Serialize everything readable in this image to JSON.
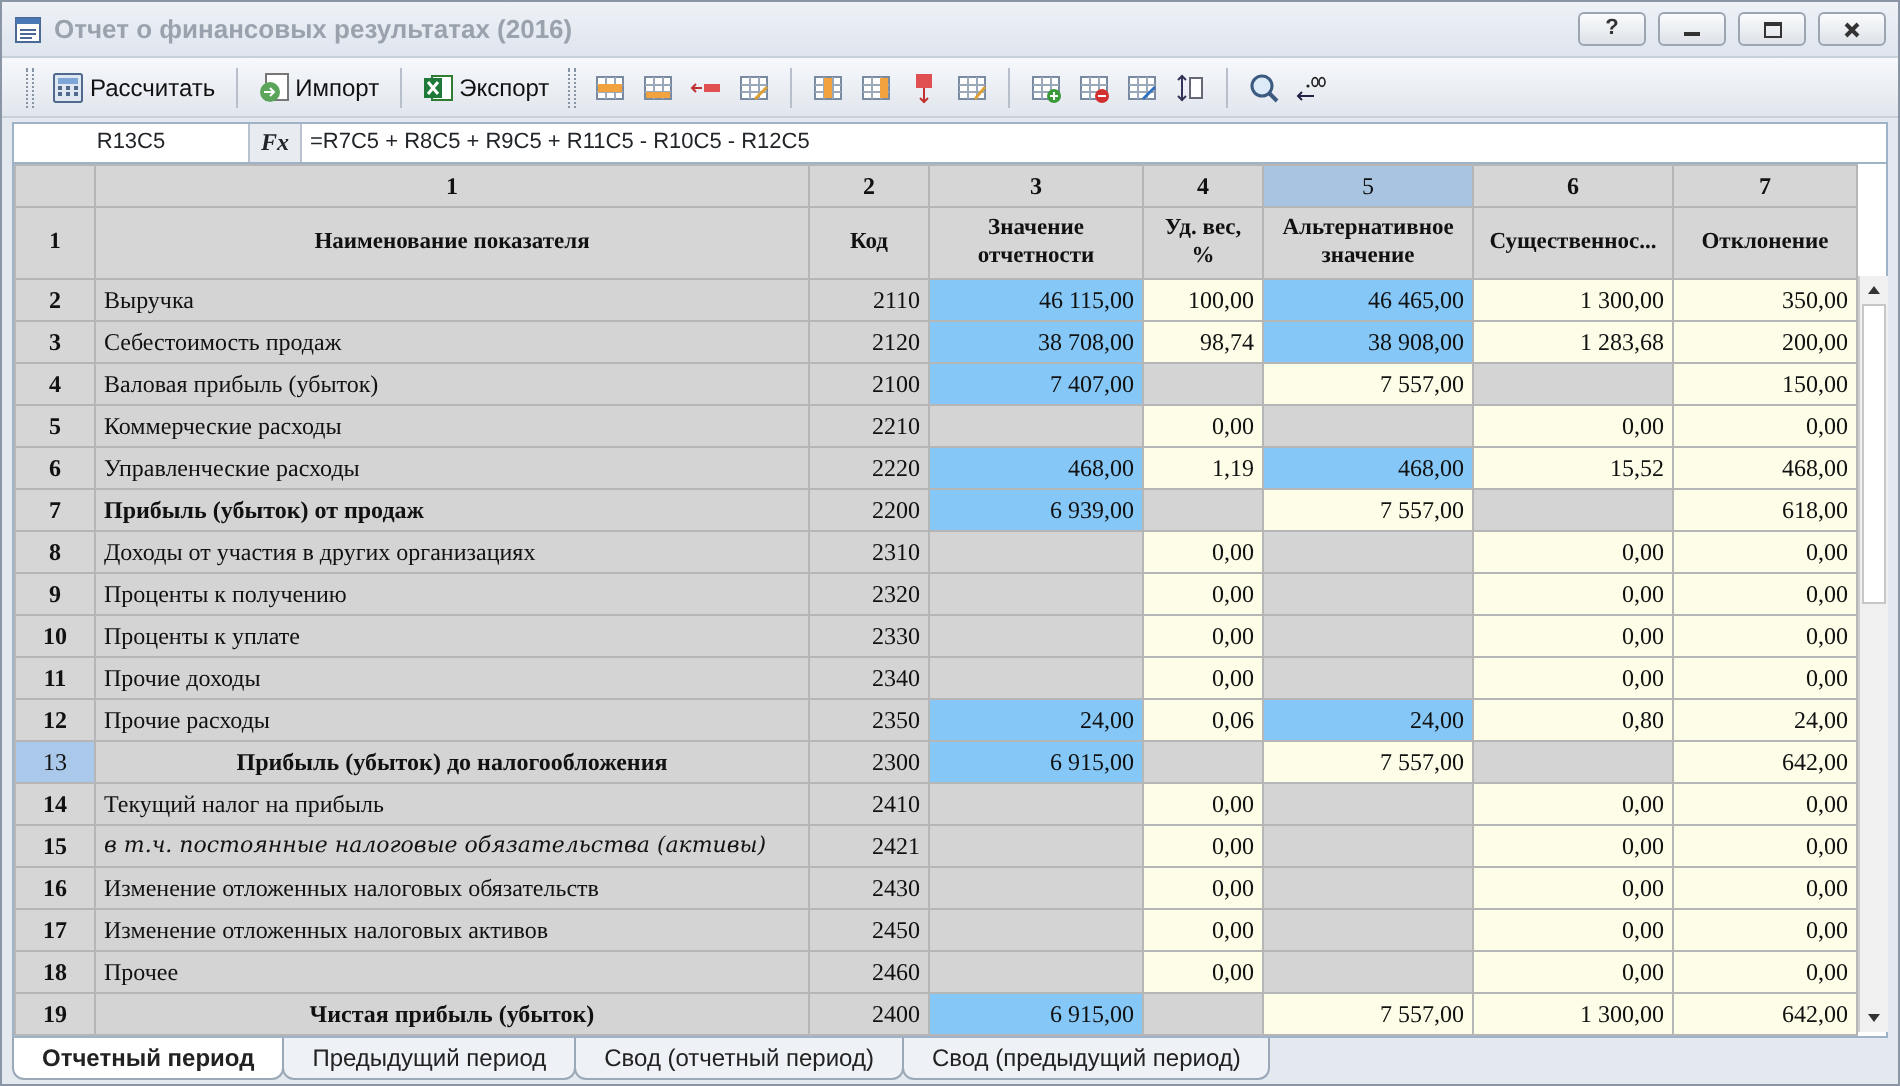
{
  "window": {
    "title": "Отчет о финансовых результатах (2016)",
    "help_button": "?"
  },
  "toolbar": {
    "buttons": [
      {
        "label": "Рассчитать",
        "kind": "calculator"
      },
      {
        "label": "Импорт",
        "kind": "import"
      },
      {
        "label": "Экспорт",
        "kind": "excel"
      }
    ]
  },
  "formula_bar": {
    "cell": "R13C5",
    "fx_label": "Fx",
    "formula": "=R7C5 + R8C5 + R9C5 + R11C5 - R10C5 - R12C5"
  },
  "table": {
    "column_numbers": [
      {
        "label": "1",
        "selected": false
      },
      {
        "label": "2",
        "selected": false
      },
      {
        "label": "3",
        "selected": false
      },
      {
        "label": "4",
        "selected": false
      },
      {
        "label": "5",
        "selected": true
      },
      {
        "label": "6",
        "selected": false
      },
      {
        "label": "7",
        "selected": false
      }
    ],
    "columns": [
      "1",
      "Наименование показателя",
      "Код",
      "Значение отчетности",
      "Уд. вес, %",
      "Альтернативное значение",
      "Существеннос...",
      "Отклонение"
    ],
    "rows": [
      {
        "selected": false,
        "kind": "plain",
        "cells": [
          {
            "value": "2",
            "kind": "number"
          },
          {
            "value": "Выручка",
            "kind": "name"
          },
          {
            "value": "2110",
            "kind": "code"
          },
          {
            "value": "46 115,00",
            "kind": "input"
          },
          {
            "value": "100,00",
            "kind": "calc"
          },
          {
            "value": "46 465,00",
            "kind": "input"
          },
          {
            "value": "1 300,00",
            "kind": "calc"
          },
          {
            "value": "350,00",
            "kind": "calc"
          }
        ]
      },
      {
        "selected": false,
        "kind": "plain",
        "cells": [
          {
            "value": "3",
            "kind": "number"
          },
          {
            "value": "Себестоимость продаж",
            "kind": "name"
          },
          {
            "value": "2120",
            "kind": "code"
          },
          {
            "value": "38 708,00",
            "kind": "input"
          },
          {
            "value": "98,74",
            "kind": "calc"
          },
          {
            "value": "38 908,00",
            "kind": "input"
          },
          {
            "value": "1 283,68",
            "kind": "calc"
          },
          {
            "value": "200,00",
            "kind": "calc"
          }
        ]
      },
      {
        "selected": false,
        "kind": "plain",
        "cells": [
          {
            "value": "4",
            "kind": "number"
          },
          {
            "value": "Валовая прибыль (убыток)",
            "kind": "name"
          },
          {
            "value": "2100",
            "kind": "code"
          },
          {
            "value": "7 407,00",
            "kind": "input"
          },
          {
            "kind": "locked"
          },
          {
            "value": "7 557,00",
            "kind": "calc"
          },
          {
            "kind": "locked"
          },
          {
            "value": "150,00",
            "kind": "calc"
          }
        ]
      },
      {
        "selected": false,
        "kind": "plain",
        "cells": [
          {
            "value": "5",
            "kind": "number"
          },
          {
            "value": "Коммерческие расходы",
            "kind": "name"
          },
          {
            "value": "2210",
            "kind": "code"
          },
          {
            "kind": "locked"
          },
          {
            "value": "0,00",
            "kind": "calc"
          },
          {
            "kind": "locked"
          },
          {
            "value": "0,00",
            "kind": "calc"
          },
          {
            "value": "0,00",
            "kind": "calc"
          }
        ]
      },
      {
        "selected": false,
        "kind": "plain",
        "cells": [
          {
            "value": "6",
            "kind": "number"
          },
          {
            "value": "Управленческие расходы",
            "kind": "name"
          },
          {
            "value": "2220",
            "kind": "code"
          },
          {
            "value": "468,00",
            "kind": "input"
          },
          {
            "value": "1,19",
            "kind": "calc"
          },
          {
            "value": "468,00",
            "kind": "input"
          },
          {
            "value": "15,52",
            "kind": "calc"
          },
          {
            "value": "468,00",
            "kind": "calc"
          }
        ]
      },
      {
        "selected": false,
        "kind": "bold",
        "cells": [
          {
            "value": "7",
            "kind": "number"
          },
          {
            "value": "Прибыль (убыток) от продаж",
            "kind": "name"
          },
          {
            "value": "2200",
            "kind": "code"
          },
          {
            "value": "6 939,00",
            "kind": "input"
          },
          {
            "kind": "locked"
          },
          {
            "value": "7 557,00",
            "kind": "calc"
          },
          {
            "kind": "locked"
          },
          {
            "value": "618,00",
            "kind": "calc"
          }
        ]
      },
      {
        "selected": false,
        "kind": "plain",
        "cells": [
          {
            "value": "8",
            "kind": "number"
          },
          {
            "value": "Доходы от участия в других организациях",
            "kind": "name"
          },
          {
            "value": "2310",
            "kind": "code"
          },
          {
            "kind": "locked"
          },
          {
            "value": "0,00",
            "kind": "calc"
          },
          {
            "kind": "locked"
          },
          {
            "value": "0,00",
            "kind": "calc"
          },
          {
            "value": "0,00",
            "kind": "calc"
          }
        ]
      },
      {
        "selected": false,
        "kind": "plain",
        "cells": [
          {
            "value": "9",
            "kind": "number"
          },
          {
            "value": "Проценты к получению",
            "kind": "name"
          },
          {
            "value": "2320",
            "kind": "code"
          },
          {
            "kind": "locked"
          },
          {
            "value": "0,00",
            "kind": "calc"
          },
          {
            "kind": "locked"
          },
          {
            "value": "0,00",
            "kind": "calc"
          },
          {
            "value": "0,00",
            "kind": "calc"
          }
        ]
      },
      {
        "selected": false,
        "kind": "plain",
        "cells": [
          {
            "value": "10",
            "kind": "number"
          },
          {
            "value": "Проценты к уплате",
            "kind": "name"
          },
          {
            "value": "2330",
            "kind": "code"
          },
          {
            "kind": "locked"
          },
          {
            "value": "0,00",
            "kind": "calc"
          },
          {
            "kind": "locked"
          },
          {
            "value": "0,00",
            "kind": "calc"
          },
          {
            "value": "0,00",
            "kind": "calc"
          }
        ]
      },
      {
        "selected": false,
        "kind": "plain",
        "cells": [
          {
            "value": "11",
            "kind": "number"
          },
          {
            "value": "Прочие доходы",
            "kind": "name"
          },
          {
            "value": "2340",
            "kind": "code"
          },
          {
            "kind": "locked"
          },
          {
            "value": "0,00",
            "kind": "calc"
          },
          {
            "kind": "locked"
          },
          {
            "value": "0,00",
            "kind": "calc"
          },
          {
            "value": "0,00",
            "kind": "calc"
          }
        ]
      },
      {
        "selected": false,
        "kind": "plain",
        "cells": [
          {
            "value": "12",
            "kind": "number"
          },
          {
            "value": "Прочие расходы",
            "kind": "name"
          },
          {
            "value": "2350",
            "kind": "code"
          },
          {
            "value": "24,00",
            "kind": "input"
          },
          {
            "value": "0,06",
            "kind": "calc"
          },
          {
            "value": "24,00",
            "kind": "input"
          },
          {
            "value": "0,80",
            "kind": "calc"
          },
          {
            "value": "24,00",
            "kind": "calc"
          }
        ]
      },
      {
        "selected": true,
        "kind": "bold-center",
        "cells": [
          {
            "value": "13",
            "kind": "number"
          },
          {
            "value": "Прибыль (убыток) до налогообложения",
            "kind": "name"
          },
          {
            "value": "2300",
            "kind": "code"
          },
          {
            "value": "6 915,00",
            "kind": "input"
          },
          {
            "kind": "locked"
          },
          {
            "value": "7 557,00",
            "kind": "calc"
          },
          {
            "kind": "locked"
          },
          {
            "value": "642,00",
            "kind": "calc"
          }
        ]
      },
      {
        "selected": false,
        "kind": "plain",
        "cells": [
          {
            "value": "14",
            "kind": "number"
          },
          {
            "value": "Текущий налог на прибыль",
            "kind": "name"
          },
          {
            "value": "2410",
            "kind": "code"
          },
          {
            "kind": "locked"
          },
          {
            "value": "0,00",
            "kind": "calc"
          },
          {
            "kind": "locked"
          },
          {
            "value": "0,00",
            "kind": "calc"
          },
          {
            "value": "0,00",
            "kind": "calc"
          }
        ]
      },
      {
        "selected": false,
        "kind": "italic",
        "cells": [
          {
            "value": "15",
            "kind": "number"
          },
          {
            "value": "в т.ч. постоянные налоговые обязательства (активы)",
            "kind": "name"
          },
          {
            "value": "2421",
            "kind": "code"
          },
          {
            "kind": "locked"
          },
          {
            "value": "0,00",
            "kind": "calc"
          },
          {
            "kind": "locked"
          },
          {
            "value": "0,00",
            "kind": "calc"
          },
          {
            "value": "0,00",
            "kind": "calc"
          }
        ]
      },
      {
        "selected": false,
        "kind": "plain",
        "cells": [
          {
            "value": "16",
            "kind": "number"
          },
          {
            "value": "Изменение отложенных налоговых обязательств",
            "kind": "name"
          },
          {
            "value": "2430",
            "kind": "code"
          },
          {
            "kind": "locked"
          },
          {
            "value": "0,00",
            "kind": "calc"
          },
          {
            "kind": "locked"
          },
          {
            "value": "0,00",
            "kind": "calc"
          },
          {
            "value": "0,00",
            "kind": "calc"
          }
        ]
      },
      {
        "selected": false,
        "kind": "plain",
        "cells": [
          {
            "value": "17",
            "kind": "number"
          },
          {
            "value": "Изменение отложенных налоговых активов",
            "kind": "name"
          },
          {
            "value": "2450",
            "kind": "code"
          },
          {
            "kind": "locked"
          },
          {
            "value": "0,00",
            "kind": "calc"
          },
          {
            "kind": "locked"
          },
          {
            "value": "0,00",
            "kind": "calc"
          },
          {
            "value": "0,00",
            "kind": "calc"
          }
        ]
      },
      {
        "selected": false,
        "kind": "plain",
        "cells": [
          {
            "value": "18",
            "kind": "number"
          },
          {
            "value": "Прочее",
            "kind": "name"
          },
          {
            "value": "2460",
            "kind": "code"
          },
          {
            "kind": "locked"
          },
          {
            "value": "0,00",
            "kind": "calc"
          },
          {
            "kind": "locked"
          },
          {
            "value": "0,00",
            "kind": "calc"
          },
          {
            "value": "0,00",
            "kind": "calc"
          }
        ]
      },
      {
        "selected": false,
        "kind": "bold-center",
        "cells": [
          {
            "value": "19",
            "kind": "number"
          },
          {
            "value": "Чистая прибыль (убыток)",
            "kind": "name"
          },
          {
            "value": "2400",
            "kind": "code"
          },
          {
            "value": "6 915,00",
            "kind": "input"
          },
          {
            "kind": "locked"
          },
          {
            "value": "7 557,00",
            "kind": "calc"
          },
          {
            "value": "1 300,00",
            "kind": "calc"
          },
          {
            "value": "642,00",
            "kind": "calc"
          }
        ]
      }
    ]
  },
  "tabs": [
    {
      "label": "Отчетный период",
      "selected": true
    },
    {
      "label": "Предыдущий период",
      "selected": false
    },
    {
      "label": "Свод (отчетный период)",
      "selected": false
    },
    {
      "label": "Свод (предыдущий период)",
      "selected": false
    }
  ]
}
